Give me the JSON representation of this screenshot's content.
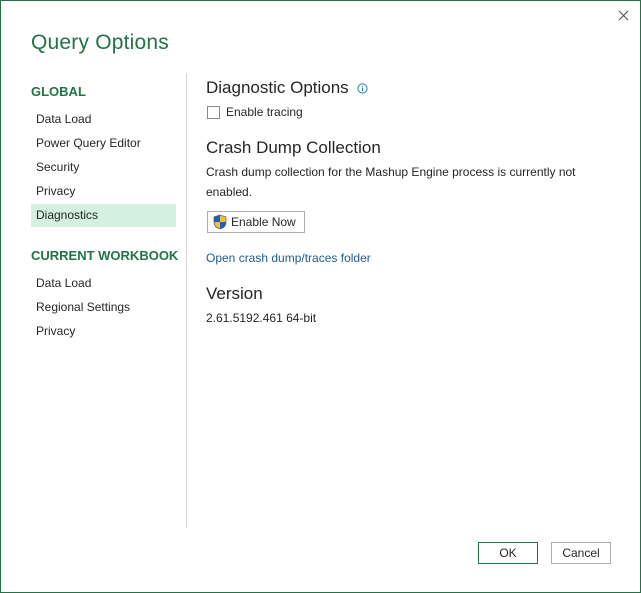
{
  "dialog": {
    "title": "Query Options"
  },
  "sidebar": {
    "global_heading": "GLOBAL",
    "global_items": [
      {
        "label": "Data Load"
      },
      {
        "label": "Power Query Editor"
      },
      {
        "label": "Security"
      },
      {
        "label": "Privacy"
      },
      {
        "label": "Diagnostics",
        "selected": true
      }
    ],
    "workbook_heading": "CURRENT WORKBOOK",
    "workbook_items": [
      {
        "label": "Data Load"
      },
      {
        "label": "Regional Settings"
      },
      {
        "label": "Privacy"
      }
    ]
  },
  "diagnostics": {
    "title": "Diagnostic Options",
    "info_icon": "info-icon",
    "tracing_label": "Enable tracing",
    "tracing_checked": false
  },
  "crash_dump": {
    "title": "Crash Dump Collection",
    "description": "Crash dump collection for the Mashup Engine process is currently not enabled.",
    "enable_button": "Enable Now",
    "enable_icon": "uac-shield-icon",
    "folder_link": "Open crash dump/traces folder"
  },
  "version": {
    "title": "Version",
    "value": "2.61.5192.461 64-bit"
  },
  "footer": {
    "ok_label": "OK",
    "cancel_label": "Cancel"
  },
  "colors": {
    "accent": "#217346",
    "selected_bg": "#d3f0e0",
    "link": "#1e5c95"
  }
}
